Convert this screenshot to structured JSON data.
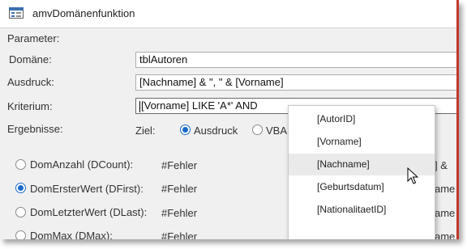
{
  "window": {
    "title": "amvDomänenfunktion"
  },
  "form": {
    "parameter_label": "Parameter:",
    "domaene_label": "Domäne:",
    "domaene_value": "tblAutoren",
    "ausdruck_label": "Ausdruck:",
    "ausdruck_value": "[Nachname] & \", \" & [Vorname]",
    "kriterium_label": "Kriterium:",
    "kriterium_value": "[Vorname] LIKE 'A*' AND",
    "ergebnisse_label": "Ergebnisse:",
    "ziel_label": "Ziel:",
    "ziel_option_ausdruck": "Ausdruck",
    "ziel_option_vba": "VBA"
  },
  "results": [
    {
      "label": "DomAnzahl (DCount):",
      "value": "#Fehler",
      "checked": false,
      "right_fragment": "] &"
    },
    {
      "label": "DomErsterWert (DFirst):",
      "value": "#Fehler",
      "checked": true,
      "right_fragment": "ame"
    },
    {
      "label": "DomLetzterWert (DLast):",
      "value": "#Fehler",
      "checked": false,
      "right_fragment": "ame"
    },
    {
      "label": "DomMax (DMax):",
      "value": "#Fehler",
      "checked": false,
      "right_fragment": "ame"
    }
  ],
  "autocomplete": {
    "items": [
      "[AutorID]",
      "[Vorname]",
      "[Nachname]",
      "[Geburtsdatum]",
      "[NationalitaetID]"
    ],
    "hover_index": 2
  },
  "colors": {
    "accent": "#1b6ac9",
    "window_edge": "#c0392b",
    "background": "#f0f0f0"
  },
  "icons": {
    "form": "form-icon",
    "cursor": "mouse-pointer-icon"
  }
}
